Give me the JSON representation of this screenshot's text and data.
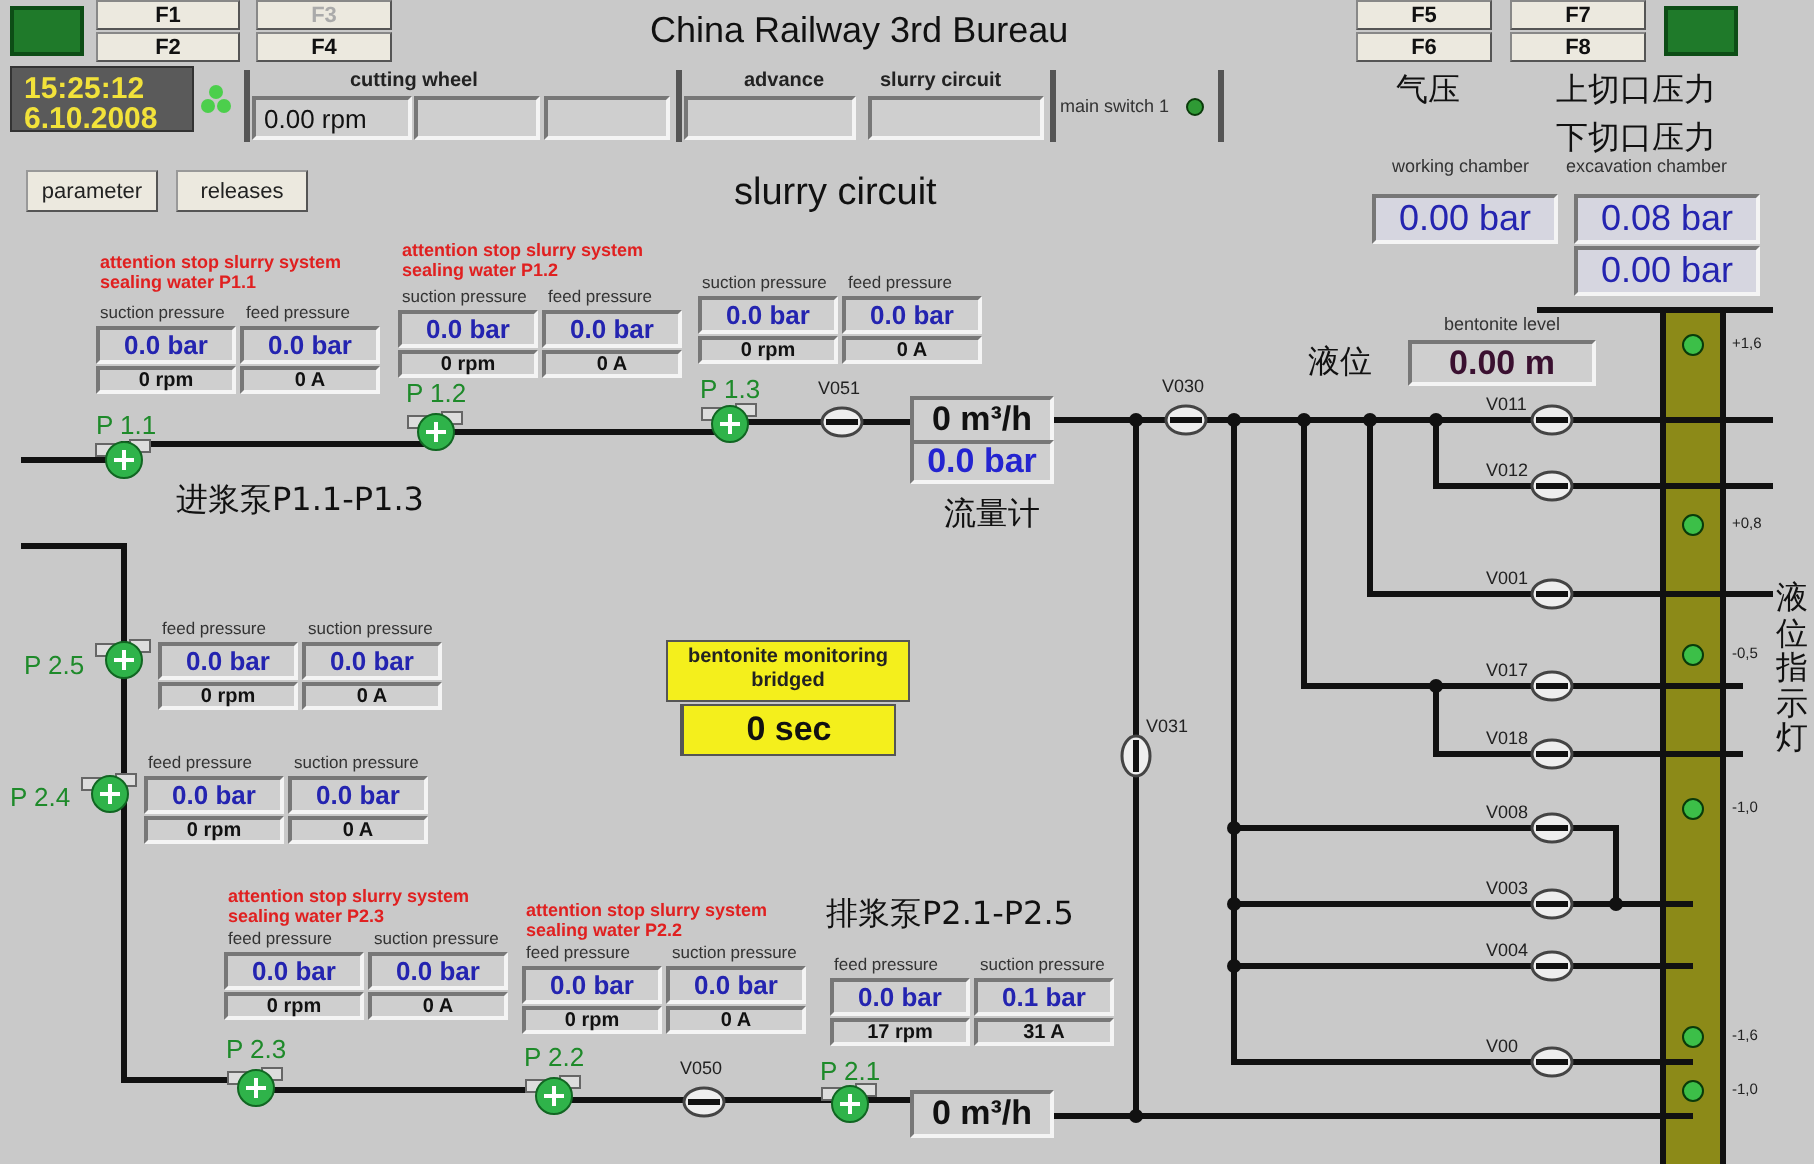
{
  "function_keys": [
    {
      "label": "F1",
      "disabled": false
    },
    {
      "label": "F2",
      "disabled": false
    },
    {
      "label": "F3",
      "disabled": true
    },
    {
      "label": "F4",
      "disabled": false
    },
    {
      "label": "F5",
      "disabled": false
    },
    {
      "label": "F6",
      "disabled": false
    },
    {
      "label": "F7",
      "disabled": false
    },
    {
      "label": "F8",
      "disabled": false
    }
  ],
  "title": "China Railway 3rd Bureau",
  "clock": {
    "time": "15:25:12",
    "date": "6.10.2008"
  },
  "header": [
    {
      "label": "cutting wheel",
      "value": "0.00 rpm"
    },
    {
      "label": "advance"
    },
    {
      "label": "slurry circuit"
    }
  ],
  "main_switch": {
    "label": "main switch 1",
    "on": true
  },
  "buttons": [
    "parameter",
    "releases"
  ],
  "heading": "slurry circuit",
  "pressure": {
    "captions": [
      "气压",
      "上切口压力",
      "下切口压力"
    ],
    "columns": [
      {
        "label": "working chamber",
        "values": [
          "0.00 bar"
        ]
      },
      {
        "label": "excavation chamber",
        "values": [
          "0.08 bar",
          "0.00 bar"
        ]
      }
    ]
  },
  "bentonite_level": {
    "caption": "液位",
    "label": "bentonite level",
    "value": "0.00 m"
  },
  "pumps": [
    {
      "name": "P 1.1",
      "alert": [
        "attention stop slurry system",
        "sealing water P1.1"
      ],
      "labels": [
        "suction pressure",
        "feed pressure"
      ],
      "values": [
        "0.0 bar",
        "0.0 bar"
      ],
      "speed": "0 rpm",
      "current": "0 A"
    },
    {
      "name": "P 1.2",
      "alert": [
        "attention stop slurry system",
        "sealing water P1.2"
      ],
      "labels": [
        "suction pressure",
        "feed pressure"
      ],
      "values": [
        "0.0 bar",
        "0.0 bar"
      ],
      "speed": "0 rpm",
      "current": "0 A"
    },
    {
      "name": "P 1.3",
      "labels": [
        "suction pressure",
        "feed pressure"
      ],
      "values": [
        "0.0 bar",
        "0.0 bar"
      ],
      "speed": "0 rpm",
      "current": "0 A"
    },
    {
      "name": "P 2.5",
      "labels": [
        "feed pressure",
        "suction pressure"
      ],
      "values": [
        "0.0 bar",
        "0.0 bar"
      ],
      "speed": "0 rpm",
      "current": "0 A"
    },
    {
      "name": "P 2.4",
      "labels": [
        "feed pressure",
        "suction pressure"
      ],
      "values": [
        "0.0 bar",
        "0.0 bar"
      ],
      "speed": "0 rpm",
      "current": "0 A"
    },
    {
      "name": "P 2.3",
      "alert": [
        "attention stop slurry system",
        "sealing water P2.3"
      ],
      "labels": [
        "feed pressure",
        "suction pressure"
      ],
      "values": [
        "0.0 bar",
        "0.0 bar"
      ],
      "speed": "0 rpm",
      "current": "0 A"
    },
    {
      "name": "P 2.2",
      "alert": [
        "attention stop slurry system",
        "sealing water P2.2"
      ],
      "labels": [
        "feed pressure",
        "suction pressure"
      ],
      "values": [
        "0.0 bar",
        "0.0 bar"
      ],
      "speed": "0 rpm",
      "current": "0 A"
    },
    {
      "name": "P 2.1",
      "labels": [
        "feed pressure",
        "suction pressure"
      ],
      "values": [
        "0.0 bar",
        "0.1 bar"
      ],
      "speed": "17 rpm",
      "current": "31 A"
    }
  ],
  "valves": [
    {
      "name": "V051"
    },
    {
      "name": "V030"
    },
    {
      "name": "V031"
    },
    {
      "name": "V011"
    },
    {
      "name": "V012"
    },
    {
      "name": "V001"
    },
    {
      "name": "V017"
    },
    {
      "name": "V018"
    },
    {
      "name": "V008"
    },
    {
      "name": "V003"
    },
    {
      "name": "V004"
    },
    {
      "name": "V00"
    },
    {
      "name": "V050"
    }
  ],
  "flow_meters": [
    {
      "flow": "0 m³/h",
      "pressure": "0.0 bar"
    },
    {
      "flow": "0 m³/h"
    }
  ],
  "notes": [
    "进浆泵P1.1-P1.3",
    "流量计",
    "排浆泵P2.1-P2.5",
    "液位指示灯"
  ],
  "bentonite_monitoring": {
    "title": "bentonite monitoring bridged",
    "value": "0 sec"
  },
  "level_scale": [
    {
      "label": "+1,6",
      "lit": true
    },
    {
      "label": "+0,8",
      "lit": true
    },
    {
      "label": "-0,5",
      "lit": true
    },
    {
      "label": "-1,0",
      "lit": true
    },
    {
      "label": "-1,6",
      "lit": true
    },
    {
      "label": "-1,0",
      "lit": true
    }
  ]
}
